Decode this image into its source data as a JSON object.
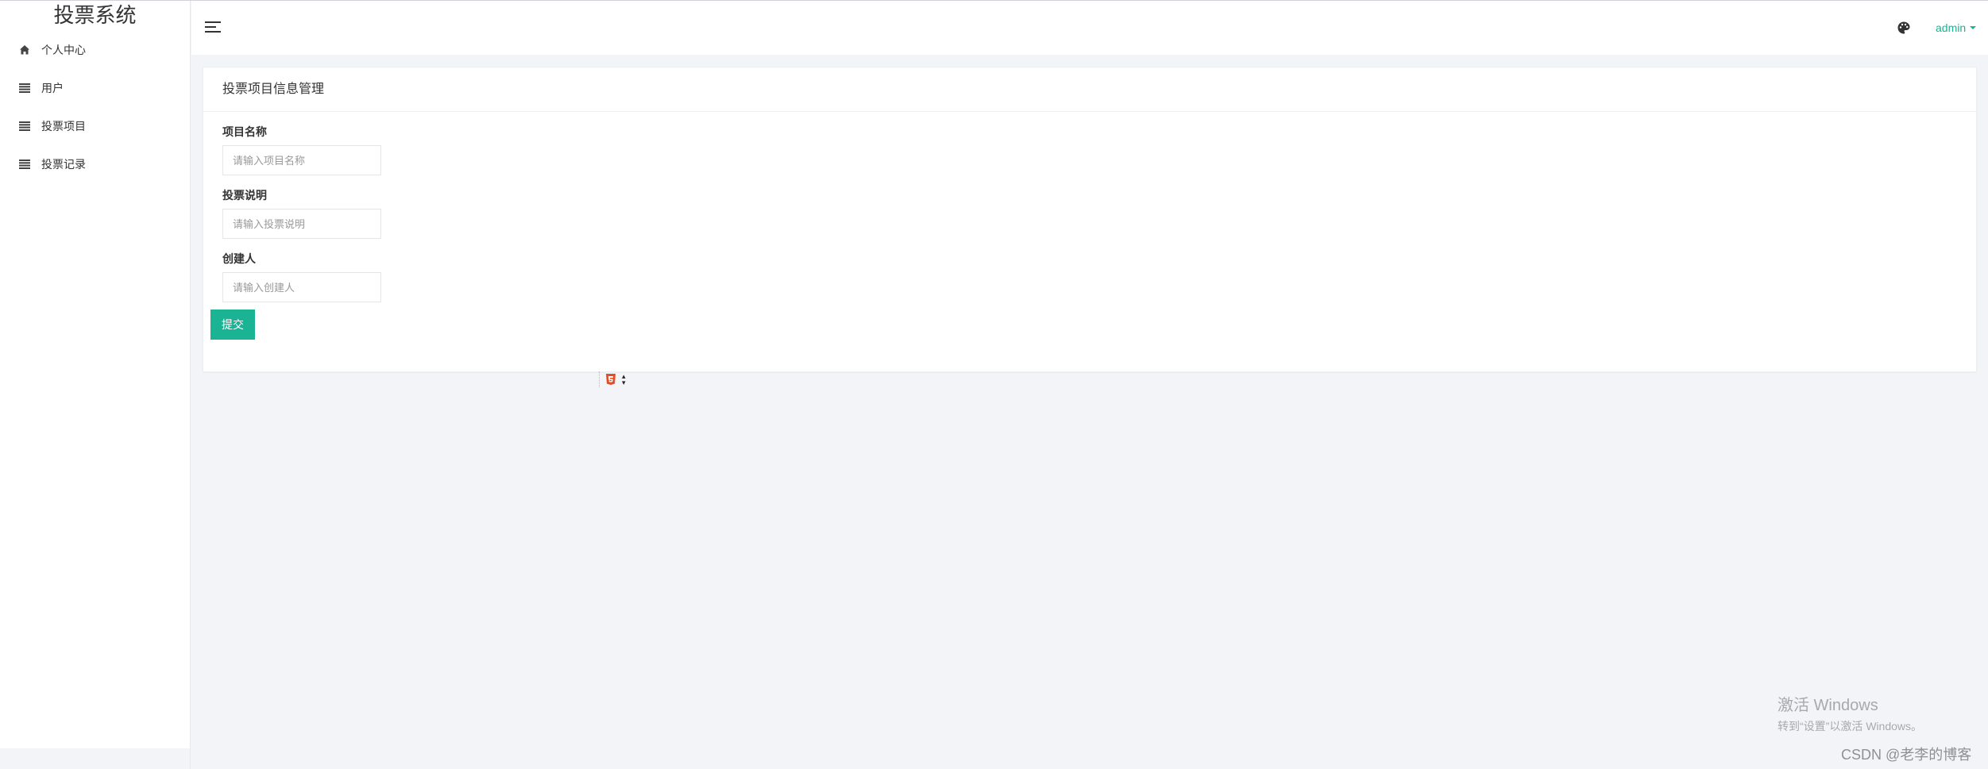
{
  "app": {
    "title": "投票系统"
  },
  "sidebar": {
    "items": [
      {
        "label": "个人中心",
        "icon": "home-icon"
      },
      {
        "label": "用户",
        "icon": "list-icon"
      },
      {
        "label": "投票项目",
        "icon": "list-icon"
      },
      {
        "label": "投票记录",
        "icon": "list-icon"
      }
    ]
  },
  "header": {
    "menu_icon": "hamburger-icon",
    "theme_icon": "palette-icon",
    "user_label": "admin",
    "accent_color": "#1ab394"
  },
  "card": {
    "title": "投票项目信息管理",
    "fields": [
      {
        "label": "项目名称",
        "placeholder": "请输入项目名称",
        "value": ""
      },
      {
        "label": "投票说明",
        "placeholder": "请输入投票说明",
        "value": ""
      },
      {
        "label": "创建人",
        "placeholder": "请输入创建人",
        "value": ""
      }
    ],
    "submit_label": "提交"
  },
  "watermark": {
    "activate_title": "激活 Windows",
    "activate_sub": "转到“设置”以激活 Windows。",
    "csdn": "CSDN @老李的博客"
  }
}
